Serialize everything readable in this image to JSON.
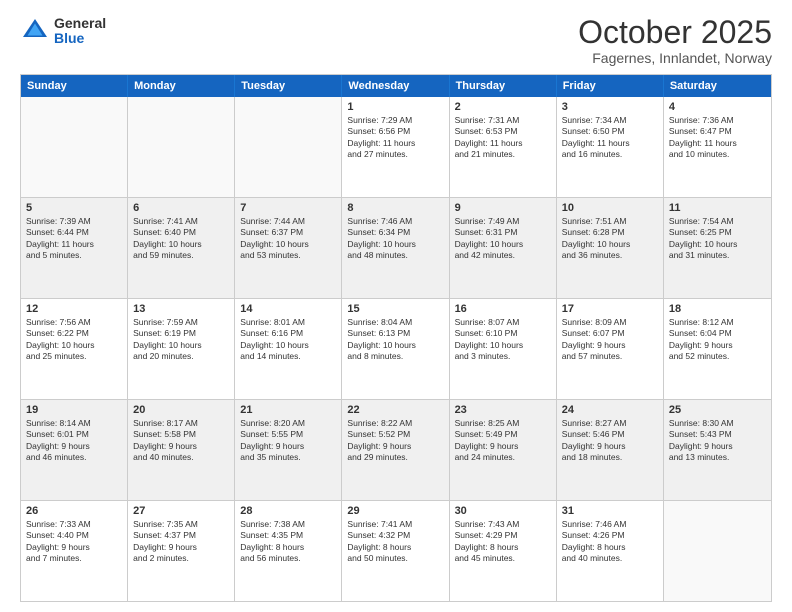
{
  "logo": {
    "general": "General",
    "blue": "Blue"
  },
  "title": "October 2025",
  "location": "Fagernes, Innlandet, Norway",
  "days_of_week": [
    "Sunday",
    "Monday",
    "Tuesday",
    "Wednesday",
    "Thursday",
    "Friday",
    "Saturday"
  ],
  "weeks": [
    [
      {
        "day": "",
        "info": "",
        "empty": true
      },
      {
        "day": "",
        "info": "",
        "empty": true
      },
      {
        "day": "",
        "info": "",
        "empty": true
      },
      {
        "day": "1",
        "info": "Sunrise: 7:29 AM\nSunset: 6:56 PM\nDaylight: 11 hours\nand 27 minutes."
      },
      {
        "day": "2",
        "info": "Sunrise: 7:31 AM\nSunset: 6:53 PM\nDaylight: 11 hours\nand 21 minutes."
      },
      {
        "day": "3",
        "info": "Sunrise: 7:34 AM\nSunset: 6:50 PM\nDaylight: 11 hours\nand 16 minutes."
      },
      {
        "day": "4",
        "info": "Sunrise: 7:36 AM\nSunset: 6:47 PM\nDaylight: 11 hours\nand 10 minutes."
      }
    ],
    [
      {
        "day": "5",
        "info": "Sunrise: 7:39 AM\nSunset: 6:44 PM\nDaylight: 11 hours\nand 5 minutes."
      },
      {
        "day": "6",
        "info": "Sunrise: 7:41 AM\nSunset: 6:40 PM\nDaylight: 10 hours\nand 59 minutes."
      },
      {
        "day": "7",
        "info": "Sunrise: 7:44 AM\nSunset: 6:37 PM\nDaylight: 10 hours\nand 53 minutes."
      },
      {
        "day": "8",
        "info": "Sunrise: 7:46 AM\nSunset: 6:34 PM\nDaylight: 10 hours\nand 48 minutes."
      },
      {
        "day": "9",
        "info": "Sunrise: 7:49 AM\nSunset: 6:31 PM\nDaylight: 10 hours\nand 42 minutes."
      },
      {
        "day": "10",
        "info": "Sunrise: 7:51 AM\nSunset: 6:28 PM\nDaylight: 10 hours\nand 36 minutes."
      },
      {
        "day": "11",
        "info": "Sunrise: 7:54 AM\nSunset: 6:25 PM\nDaylight: 10 hours\nand 31 minutes."
      }
    ],
    [
      {
        "day": "12",
        "info": "Sunrise: 7:56 AM\nSunset: 6:22 PM\nDaylight: 10 hours\nand 25 minutes."
      },
      {
        "day": "13",
        "info": "Sunrise: 7:59 AM\nSunset: 6:19 PM\nDaylight: 10 hours\nand 20 minutes."
      },
      {
        "day": "14",
        "info": "Sunrise: 8:01 AM\nSunset: 6:16 PM\nDaylight: 10 hours\nand 14 minutes."
      },
      {
        "day": "15",
        "info": "Sunrise: 8:04 AM\nSunset: 6:13 PM\nDaylight: 10 hours\nand 8 minutes."
      },
      {
        "day": "16",
        "info": "Sunrise: 8:07 AM\nSunset: 6:10 PM\nDaylight: 10 hours\nand 3 minutes."
      },
      {
        "day": "17",
        "info": "Sunrise: 8:09 AM\nSunset: 6:07 PM\nDaylight: 9 hours\nand 57 minutes."
      },
      {
        "day": "18",
        "info": "Sunrise: 8:12 AM\nSunset: 6:04 PM\nDaylight: 9 hours\nand 52 minutes."
      }
    ],
    [
      {
        "day": "19",
        "info": "Sunrise: 8:14 AM\nSunset: 6:01 PM\nDaylight: 9 hours\nand 46 minutes."
      },
      {
        "day": "20",
        "info": "Sunrise: 8:17 AM\nSunset: 5:58 PM\nDaylight: 9 hours\nand 40 minutes."
      },
      {
        "day": "21",
        "info": "Sunrise: 8:20 AM\nSunset: 5:55 PM\nDaylight: 9 hours\nand 35 minutes."
      },
      {
        "day": "22",
        "info": "Sunrise: 8:22 AM\nSunset: 5:52 PM\nDaylight: 9 hours\nand 29 minutes."
      },
      {
        "day": "23",
        "info": "Sunrise: 8:25 AM\nSunset: 5:49 PM\nDaylight: 9 hours\nand 24 minutes."
      },
      {
        "day": "24",
        "info": "Sunrise: 8:27 AM\nSunset: 5:46 PM\nDaylight: 9 hours\nand 18 minutes."
      },
      {
        "day": "25",
        "info": "Sunrise: 8:30 AM\nSunset: 5:43 PM\nDaylight: 9 hours\nand 13 minutes."
      }
    ],
    [
      {
        "day": "26",
        "info": "Sunrise: 7:33 AM\nSunset: 4:40 PM\nDaylight: 9 hours\nand 7 minutes."
      },
      {
        "day": "27",
        "info": "Sunrise: 7:35 AM\nSunset: 4:37 PM\nDaylight: 9 hours\nand 2 minutes."
      },
      {
        "day": "28",
        "info": "Sunrise: 7:38 AM\nSunset: 4:35 PM\nDaylight: 8 hours\nand 56 minutes."
      },
      {
        "day": "29",
        "info": "Sunrise: 7:41 AM\nSunset: 4:32 PM\nDaylight: 8 hours\nand 50 minutes."
      },
      {
        "day": "30",
        "info": "Sunrise: 7:43 AM\nSunset: 4:29 PM\nDaylight: 8 hours\nand 45 minutes."
      },
      {
        "day": "31",
        "info": "Sunrise: 7:46 AM\nSunset: 4:26 PM\nDaylight: 8 hours\nand 40 minutes."
      },
      {
        "day": "",
        "info": "",
        "empty": true
      }
    ]
  ]
}
